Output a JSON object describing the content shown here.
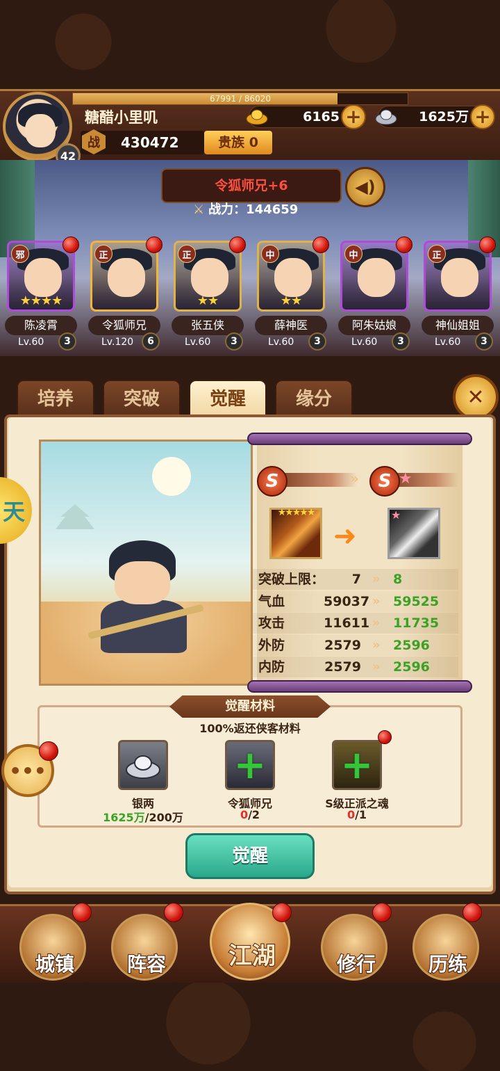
{
  "player": {
    "name": "糖醋小里叽",
    "level": "42",
    "exp_text": "67991 / 86020",
    "exp_ratio": 0.79,
    "power_icon": "战",
    "combat_power": "430472",
    "noble_label": "贵族",
    "noble_level": "0",
    "gold": "6165",
    "silver": "1625万"
  },
  "hero_title": "令狐师兄+6",
  "hero_power_label": "战力：",
  "hero_power": "144659",
  "heroes": [
    {
      "name": "陈凌霄",
      "level": "Lv.60",
      "star_num": "3",
      "sect": "邪",
      "stars": "★★★★",
      "frame": "#b04ad8"
    },
    {
      "name": "令狐师兄",
      "level": "Lv.120",
      "star_num": "6",
      "sect": "正",
      "stars": "",
      "frame": "#f2b43a"
    },
    {
      "name": "张五侠",
      "level": "Lv.60",
      "star_num": "3",
      "sect": "正",
      "stars": "★★",
      "frame": "#e0b34a"
    },
    {
      "name": "薛神医",
      "level": "Lv.60",
      "star_num": "3",
      "sect": "中",
      "stars": "★★",
      "frame": "#e0b34a"
    },
    {
      "name": "阿朱姑娘",
      "level": "Lv.60",
      "star_num": "3",
      "sect": "中",
      "stars": "",
      "frame": "#b04ad8"
    },
    {
      "name": "神仙姐姐",
      "level": "Lv.60",
      "star_num": "3",
      "sect": "正",
      "stars": "",
      "frame": "#b04ad8"
    }
  ],
  "tabs": [
    "培养",
    "突破",
    "觉醒",
    "缘分"
  ],
  "side_tab": "天",
  "grade_letter": "S",
  "stats": [
    {
      "label": "突破上限：",
      "old": "7",
      "new": "8"
    },
    {
      "label": "气血",
      "old": "59037",
      "new": "59525"
    },
    {
      "label": "攻击",
      "old": "11611",
      "new": "11735"
    },
    {
      "label": "外防",
      "old": "2579",
      "new": "2596"
    },
    {
      "label": "内防",
      "old": "2579",
      "new": "2596"
    }
  ],
  "materials_title": "觉醒材料",
  "materials_subtitle": "100%返还侠客材料",
  "materials": [
    {
      "name": "银两",
      "have": "1625万",
      "need": "/200万"
    },
    {
      "name": "令狐师兄",
      "have": "0",
      "need": "/2"
    },
    {
      "name": "S级正派之魂",
      "have": "0",
      "need": "/1"
    }
  ],
  "awaken_button": "觉醒",
  "nav": [
    "城镇",
    "阵容",
    "江湖",
    "修行",
    "历练"
  ],
  "colors": {
    "accent_green": "#3ca227",
    "alert_red": "#e0302a",
    "awaken_button": "#2aa88a"
  }
}
